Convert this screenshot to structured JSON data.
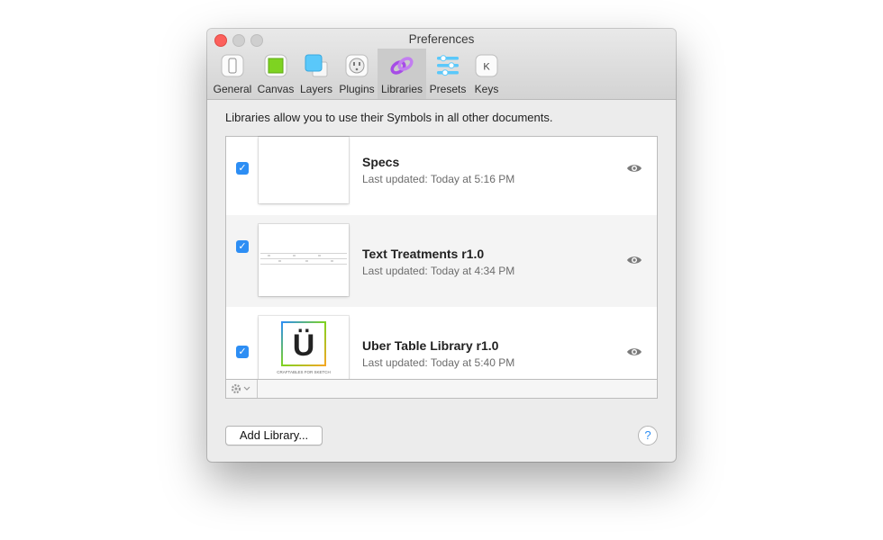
{
  "window": {
    "title": "Preferences"
  },
  "toolbar": {
    "items": [
      {
        "label": "General",
        "icon": "general-icon"
      },
      {
        "label": "Canvas",
        "icon": "canvas-icon"
      },
      {
        "label": "Layers",
        "icon": "layers-icon"
      },
      {
        "label": "Plugins",
        "icon": "plugins-icon"
      },
      {
        "label": "Libraries",
        "icon": "libraries-icon",
        "selected": true
      },
      {
        "label": "Presets",
        "icon": "presets-icon"
      },
      {
        "label": "Keys",
        "icon": "keys-icon",
        "glyph": "K"
      }
    ]
  },
  "libraries": {
    "description": "Libraries allow you to use their Symbols in all other documents.",
    "items": [
      {
        "name": "Specs",
        "updated": "Last updated: Today at 5:16 PM",
        "checked": true
      },
      {
        "name": "Text Treatments r1.0",
        "updated": "Last updated: Today at 4:34 PM",
        "checked": true
      },
      {
        "name": "Uber Table Library r1.0",
        "updated": "Last updated: Today at 5:40 PM",
        "checked": true,
        "thumb_glyph": "Ü",
        "thumb_caption": "CRAFTABLES FOR SKETCH"
      }
    ],
    "add_button": "Add Library...",
    "help": "?"
  },
  "colors": {
    "accent": "#2d8ef4",
    "close": "#fc605c",
    "selected_tab": "#cbcbcb"
  }
}
